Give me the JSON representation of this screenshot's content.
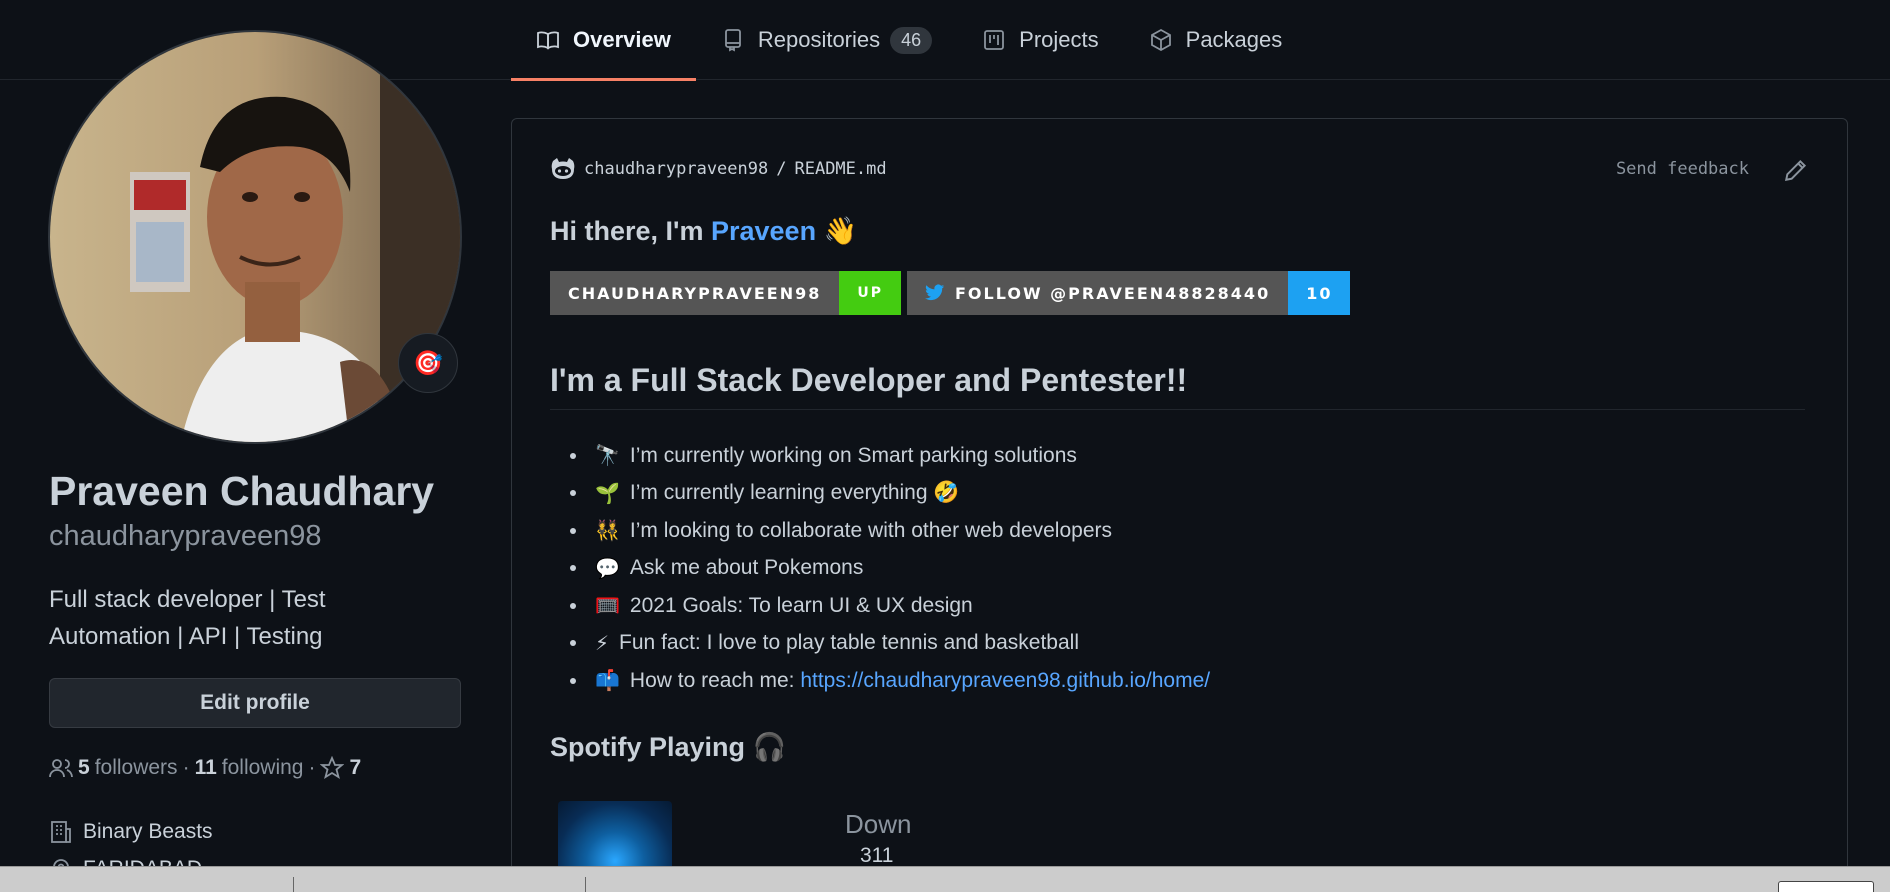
{
  "nav": {
    "tabs": [
      {
        "label": "Overview",
        "icon": "book-icon"
      },
      {
        "label": "Repositories",
        "icon": "repo-icon",
        "count": "46"
      },
      {
        "label": "Projects",
        "icon": "project-icon"
      },
      {
        "label": "Packages",
        "icon": "package-icon"
      }
    ]
  },
  "profile": {
    "fullname": "Praveen Chaudhary",
    "username": "chaudharypraveen98",
    "bio": "Full stack developer | Test Automation | API | Testing",
    "status_emoji": "🎯",
    "edit_label": "Edit profile",
    "followers_count": "5",
    "followers_label": "followers",
    "following_count": "11",
    "following_label": "following",
    "stars_count": "7",
    "org": "Binary Beasts",
    "location": "FARIDABAD"
  },
  "readme": {
    "owner": "chaudharypraveen98",
    "file": "README.md",
    "feedback_label": "Send feedback",
    "hi_prefix": "Hi there, I'm",
    "hi_name": "Praveen",
    "hi_emoji": "👋",
    "badge1_left": "CHAUDHARYPRAVEEN98",
    "badge1_right": "UP",
    "badge2_left": "FOLLOW @PRAVEEN48828440",
    "badge2_right": "10",
    "heading": "I'm a Full Stack Developer and Pentester!!",
    "items": [
      {
        "emoji": "🔭",
        "text": "I’m currently working on Smart parking solutions"
      },
      {
        "emoji": "🌱",
        "text": "I’m currently learning everything 🤣"
      },
      {
        "emoji": "👯",
        "text": "I’m looking to collaborate with other web developers"
      },
      {
        "emoji": "💬",
        "text": "Ask me about Pokemons"
      },
      {
        "emoji": "🥅",
        "text": "2021 Goals: To learn UI & UX design"
      },
      {
        "emoji": "⚡",
        "text": "Fun fact: I love to play table tennis and basketball"
      },
      {
        "emoji": "📫",
        "text": "How to reach me:",
        "link": "https://chaudharypraveen98.github.io/home/"
      }
    ],
    "spotify_title": "Spotify Playing 🎧",
    "song": "Down",
    "artist": "311"
  },
  "colors": {
    "background": "#0d1117",
    "accent": "#58a6ff",
    "tab_underline": "#f78166"
  }
}
